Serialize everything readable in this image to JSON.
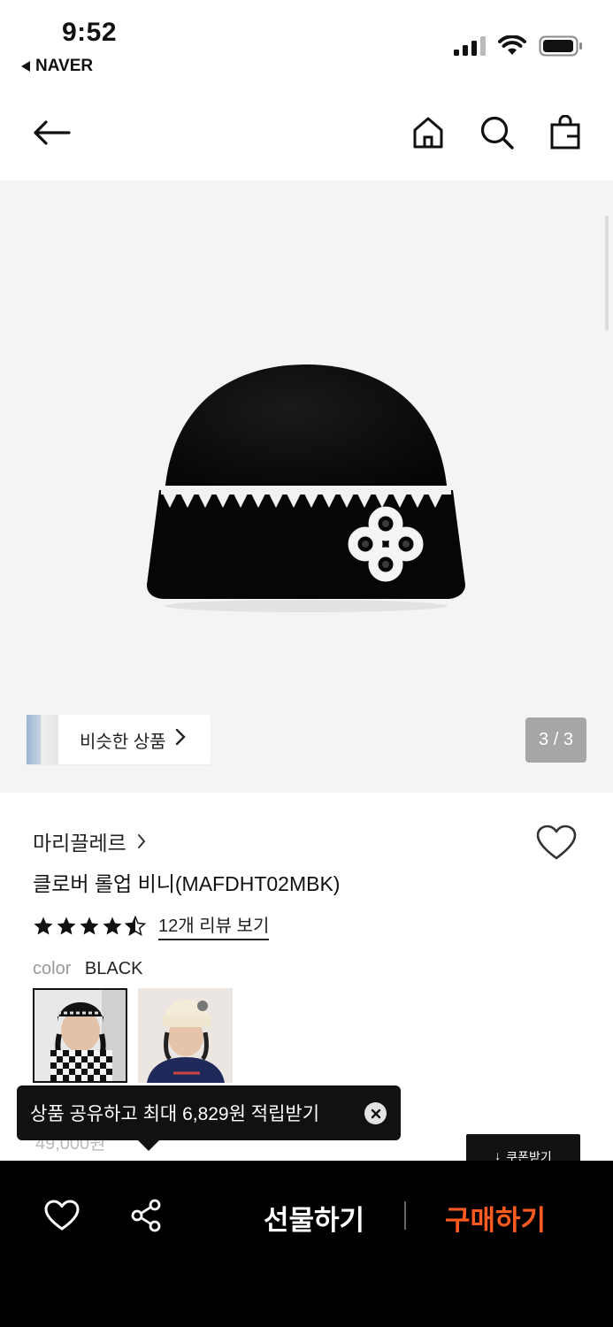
{
  "status_bar": {
    "time": "9:52",
    "back_app": "NAVER"
  },
  "gallery": {
    "similar_label": "비슷한 상품",
    "page_counter": "3 / 3"
  },
  "product": {
    "brand": "마리끌레르",
    "name": "클로버 롤업 비니(MAFDHT02MBK)",
    "rating": 4.5,
    "review_link": "12개 리뷰 보기",
    "color_label": "color",
    "color_value": "BLACK",
    "swatches": [
      "black",
      "ivory"
    ],
    "price_partial": "49,000원"
  },
  "coupon": {
    "label": "쿠폰받기"
  },
  "tooltip": {
    "text": "상품 공유하고 최대 6,829원 적립받기"
  },
  "bottom_bar": {
    "gift_label": "선물하기",
    "buy_label": "구매하기"
  },
  "colors": {
    "buy_accent": "#ff5a1f",
    "bar_bg": "#000000"
  }
}
